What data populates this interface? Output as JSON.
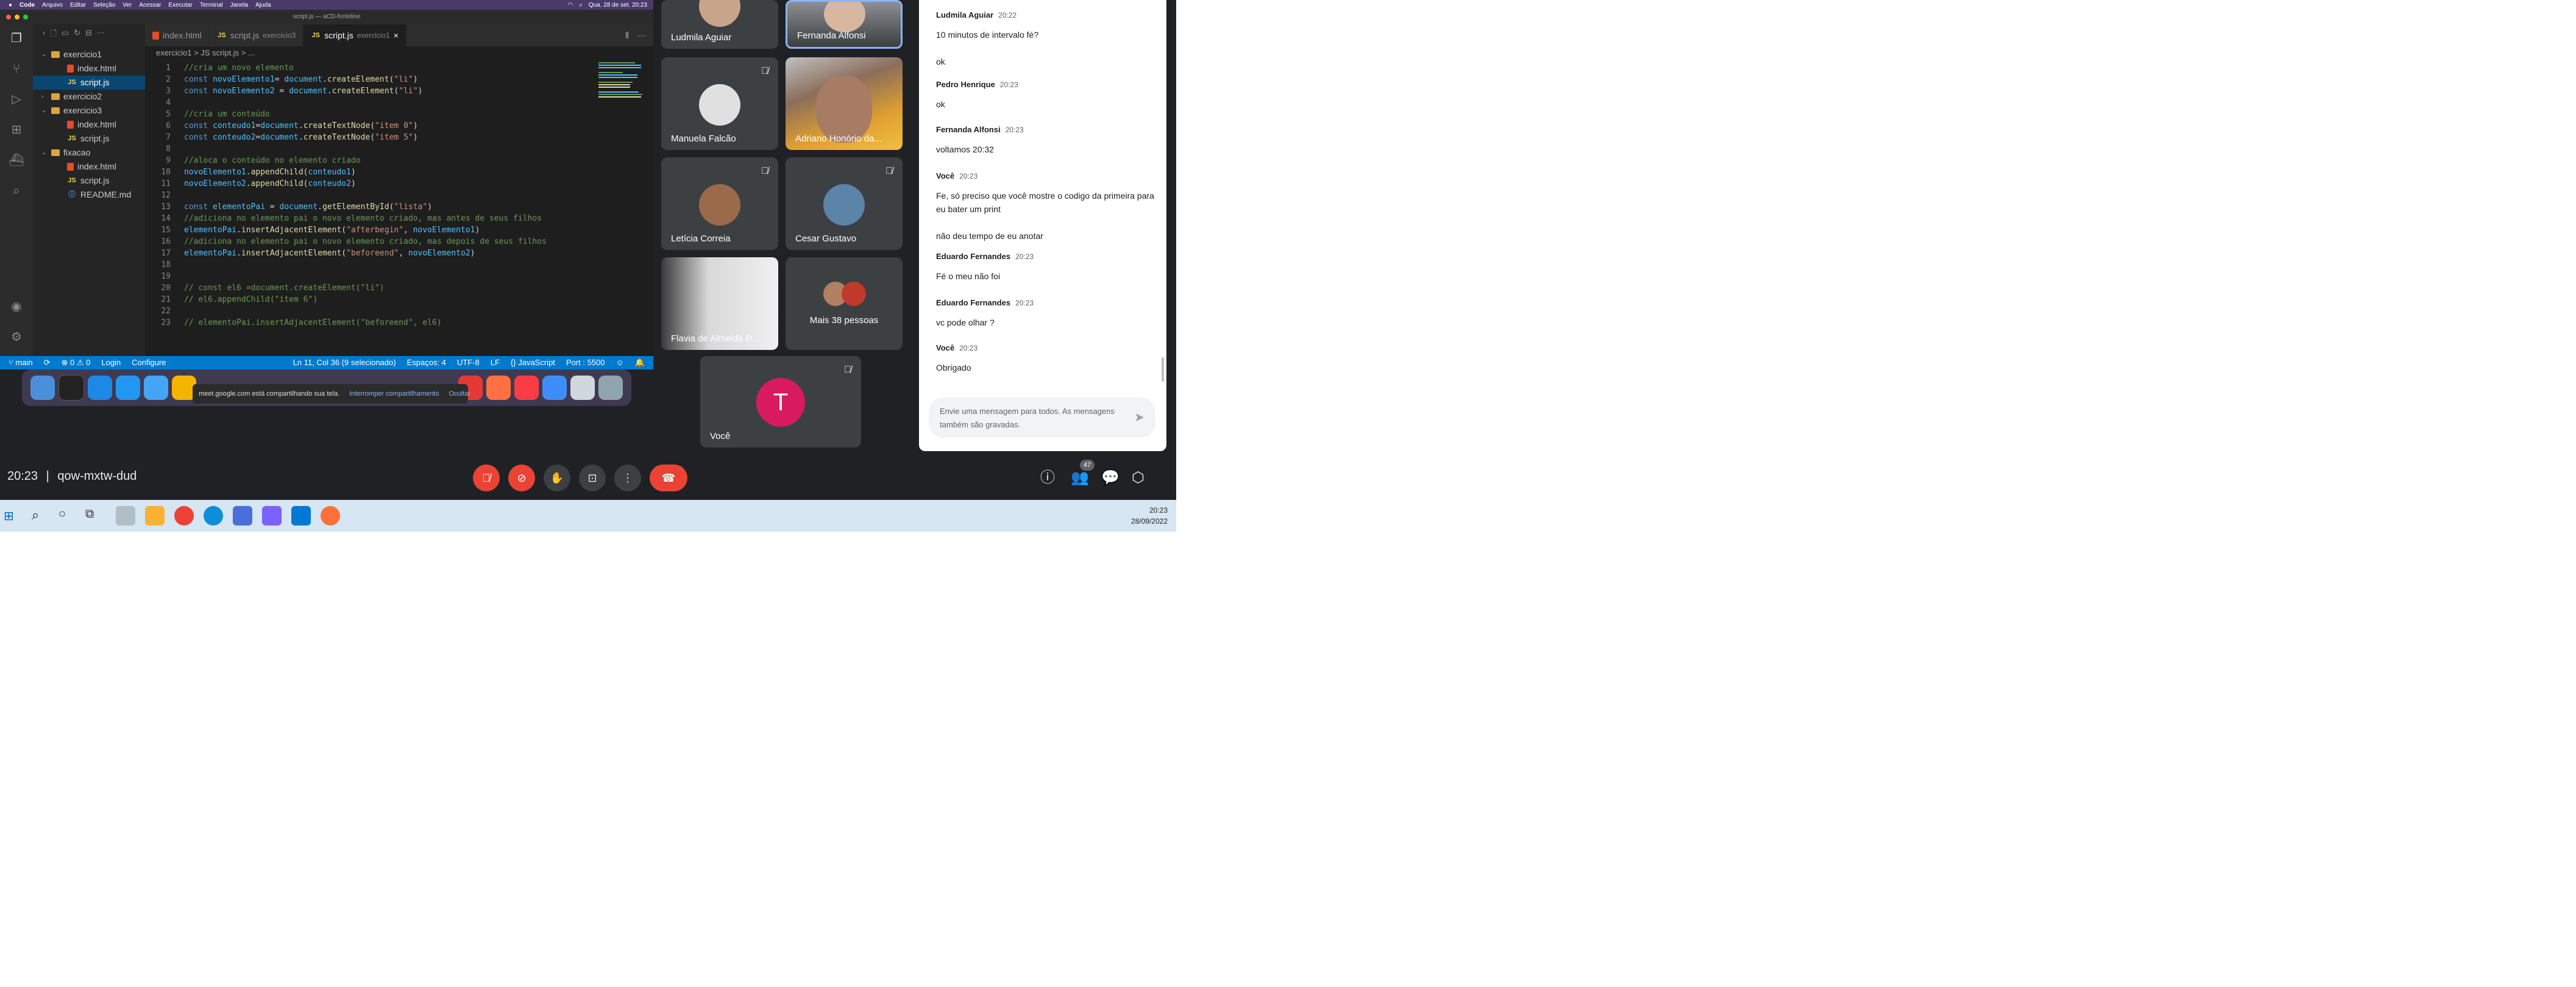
{
  "mac_menubar": {
    "app": "Code",
    "menus": [
      "Arquivo",
      "Editar",
      "Seleção",
      "Ver",
      "Acessar",
      "Executar",
      "Terminal",
      "Janela",
      "Ajuda"
    ],
    "datetime": "Qua. 28 de set.  20:23"
  },
  "vscode": {
    "window_title": "script.js — aCD-fonteline",
    "explorer": [
      {
        "label": "exercicio1",
        "type": "folder",
        "open": true,
        "indent": 0
      },
      {
        "label": "index.html",
        "type": "html",
        "indent": 1
      },
      {
        "label": "script.js",
        "type": "js",
        "indent": 1,
        "selected": true
      },
      {
        "label": "exercicio2",
        "type": "folder",
        "open": false,
        "indent": 0
      },
      {
        "label": "exercicio3",
        "type": "folder",
        "open": true,
        "indent": 0
      },
      {
        "label": "index.html",
        "type": "html",
        "indent": 1
      },
      {
        "label": "script.js",
        "type": "js",
        "indent": 1
      },
      {
        "label": "fixacao",
        "type": "folder",
        "open": true,
        "indent": 0
      },
      {
        "label": "index.html",
        "type": "html",
        "indent": 1
      },
      {
        "label": "script.js",
        "type": "js",
        "indent": 1
      },
      {
        "label": "README.md",
        "type": "md",
        "indent": 1
      }
    ],
    "tabs": [
      {
        "label": "index.html",
        "sub": "",
        "type": "html",
        "active": false
      },
      {
        "label": "script.js",
        "sub": "exercicio3",
        "type": "js",
        "active": false
      },
      {
        "label": "script.js",
        "sub": "exercicio1",
        "type": "js",
        "active": true
      }
    ],
    "breadcrumb": "exercicio1 > JS script.js > ...",
    "code_lines": [
      "//cria um novo elemento",
      "const novoElemento1= document.createElement(\"li\")",
      "const novoElemento2 = document.createElement(\"li\")",
      "",
      "//cria um conteúdo",
      "const conteudo1=document.createTextNode(\"item 0\")",
      "const conteudo2=document.createTextNode(\"item 5\")",
      "",
      "//aloca o conteúdo no elemento criado",
      "novoElemento1.appendChild(conteudo1)",
      "novoElemento2.appendChild(conteudo2)",
      "",
      "const elementoPai = document.getElementById(\"lista\")",
      "//adiciona no elemento pai o novo elemento criado, mas antes de seus filhos",
      "elementoPai.insertAdjacentElement(\"afterbegin\", novoElemento1)",
      "//adiciona no elemento pai o novo elemento criado, mas depois de seus filhos",
      "elementoPai.insertAdjacentElement(\"beforeend\", novoElemento2)",
      "",
      "",
      "// const el6 =document.createElement(\"li\")",
      "// el6.appendChild(\"item 6\")",
      "",
      "// elementoPai.insertAdjacentElement(\"beforeend\", el6)"
    ],
    "statusbar": {
      "branch": "main",
      "problems": "⊗ 0 ⚠ 0",
      "login": "Login",
      "configure": "Configure",
      "position": "Ln 11, Col 36 (9 selecionado)",
      "spaces": "Espaços: 4",
      "encoding": "UTF-8",
      "eol": "LF",
      "language": "{} JavaScript",
      "port": "Port : 5500"
    },
    "share_bar": {
      "text": "meet.google.com está compartilhando sua tela.",
      "stop": "Interromper compartilhamento",
      "hide": "Ocultar"
    }
  },
  "participants": [
    {
      "name": "Ludmila Aguiar",
      "muted": false,
      "style": "photo"
    },
    {
      "name": "Fernanda Alfonsi",
      "muted": false,
      "style": "video-top"
    },
    {
      "name": "Manuela Falcão",
      "muted": true,
      "style": "photo"
    },
    {
      "name": "Adriano Honório da...",
      "muted": false,
      "style": "video"
    },
    {
      "name": "Letícia Correia",
      "muted": true,
      "style": "photo"
    },
    {
      "name": "Cesar Gustavo",
      "muted": true,
      "style": "photo"
    },
    {
      "name": "Flavia de Almeida P...",
      "muted": true,
      "style": "video-room"
    },
    {
      "name": "Mais 38 pessoas",
      "muted": false,
      "style": "group"
    },
    {
      "name": "Você",
      "muted": true,
      "style": "letter",
      "letter": "T"
    }
  ],
  "chat": {
    "messages": [
      {
        "sender": "Ludmila Aguiar",
        "time": "20:22",
        "lines": [
          "10 minutos de intervalo fé?",
          "ok"
        ]
      },
      {
        "sender": "Pedro Henrique",
        "time": "20:23",
        "lines": [
          "ok"
        ]
      },
      {
        "sender": "Fernanda Alfonsi",
        "time": "20:23",
        "lines": [
          "voltamos 20:32"
        ]
      },
      {
        "sender": "Você",
        "time": "20:23",
        "lines": [
          "Fe, só preciso que você mostre o codigo da primeira para eu bater um print",
          "não deu tempo de eu anotar"
        ]
      },
      {
        "sender": "Eduardo Fernandes",
        "time": "20:23",
        "lines": [
          "Fé o meu não foi"
        ]
      },
      {
        "sender": "Eduardo Fernandes",
        "time": "20:23",
        "lines": [
          "vc pode olhar ?"
        ]
      },
      {
        "sender": "Você",
        "time": "20:23",
        "lines": [
          "Obrigado"
        ]
      }
    ],
    "input_placeholder": "Envie uma mensagem para todos. As mensagens também são gravadas."
  },
  "meeting": {
    "time": "20:23",
    "separator": "|",
    "code": "qow-mxtw-dud",
    "people_count": "47"
  },
  "taskbar": {
    "time": "20:23",
    "date": "28/09/2022"
  },
  "colors": {
    "meet_bg": "#202124",
    "tile_bg": "#3c4043",
    "danger": "#ea4335",
    "active_tile_border": "#8ab4f8",
    "vscode_status": "#007acc",
    "avatar_letter_bg": "#d81b60"
  }
}
